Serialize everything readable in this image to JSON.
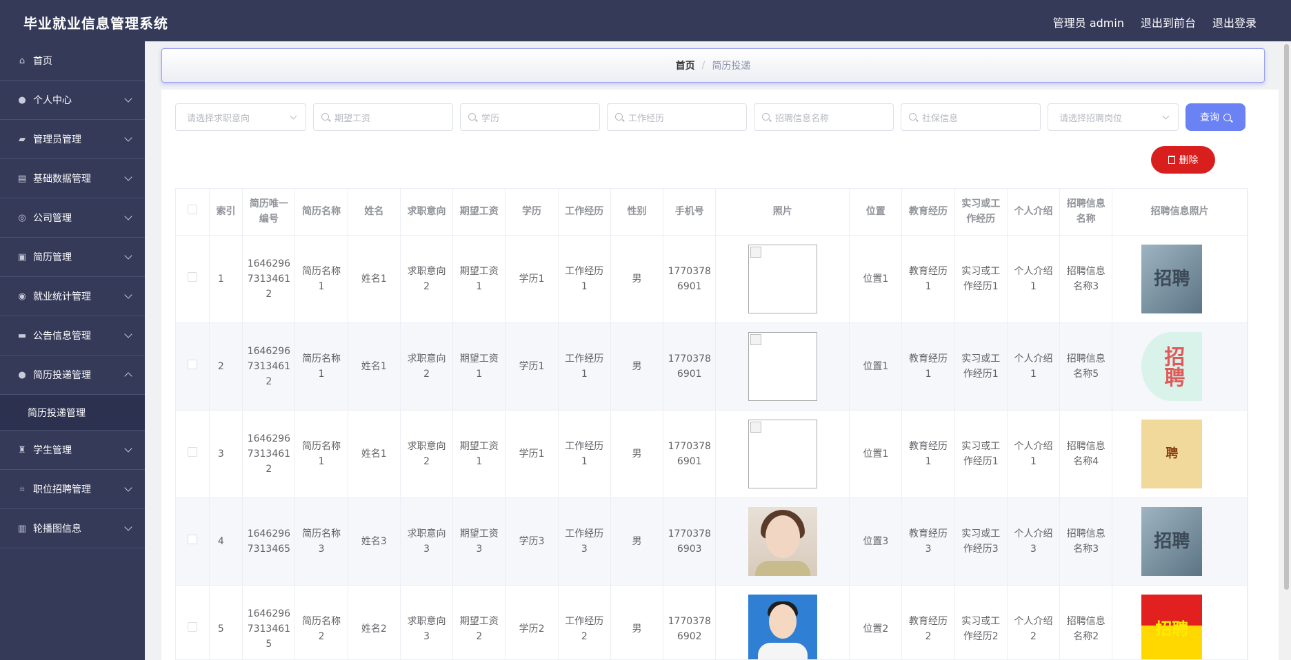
{
  "app": {
    "title": "毕业就业信息管理系统"
  },
  "topbar": {
    "admin_label": "管理员 admin",
    "front_label": "退出到前台",
    "logout_label": "退出登录"
  },
  "sidebar": {
    "items": [
      {
        "label": "首页",
        "icon": "home-icon"
      },
      {
        "label": "个人中心",
        "icon": "user-icon"
      },
      {
        "label": "管理员管理",
        "icon": "admin-icon"
      },
      {
        "label": "基础数据管理",
        "icon": "clipboard-icon"
      },
      {
        "label": "公司管理",
        "icon": "compass-icon"
      },
      {
        "label": "简历管理",
        "icon": "resume-icon"
      },
      {
        "label": "就业统计管理",
        "icon": "chart-circle-icon"
      },
      {
        "label": "公告信息管理",
        "icon": "briefcase-icon"
      },
      {
        "label": "简历投递管理",
        "icon": "user-icon"
      },
      {
        "label": "学生管理",
        "icon": "trophy-icon"
      },
      {
        "label": "职位招聘管理",
        "icon": "crop-icon"
      },
      {
        "label": "轮播图信息",
        "icon": "bar-chart-icon"
      }
    ],
    "sub_item": "简历投递管理"
  },
  "breadcrumb": {
    "home": "首页",
    "separator": "/",
    "current": "简历投递"
  },
  "filters": {
    "job_intent": "请选择求职意向",
    "salary": "期望工资",
    "education": "学历",
    "experience": "工作经历",
    "recruit_name": "招聘信息名称",
    "social": "社保信息",
    "position": "请选择招聘岗位",
    "query": "查询"
  },
  "delete_label": "删除",
  "table": {
    "headers": [
      "索引",
      "简历唯一编号",
      "简历名称",
      "姓名",
      "求职意向",
      "期望工资",
      "学历",
      "工作经历",
      "性别",
      "手机号",
      "照片",
      "位置",
      "教育经历",
      "实习或工作经历",
      "个人介绍",
      "招聘信息名称",
      "招聘信息照片"
    ],
    "rows": [
      {
        "index": "1",
        "uid": "16462967313461 2",
        "resume": "简历名称1",
        "name": "姓名1",
        "intent": "求职意向2",
        "salary": "期望工资1",
        "edu": "学历1",
        "work": "工作经历1",
        "gender": "男",
        "phone": "17703786901",
        "location": "位置1",
        "education_exp": "教育经历1",
        "intern": "实习或工作经历1",
        "intro": "个人介绍1",
        "recruit": "招聘信息名称3"
      },
      {
        "index": "2",
        "uid": "16462967313461 2",
        "resume": "简历名称1",
        "name": "姓名1",
        "intent": "求职意向2",
        "salary": "期望工资1",
        "edu": "学历1",
        "work": "工作经历1",
        "gender": "男",
        "phone": "17703786901",
        "location": "位置1",
        "education_exp": "教育经历1",
        "intern": "实习或工作经历1",
        "intro": "个人介绍1",
        "recruit": "招聘信息名称5"
      },
      {
        "index": "3",
        "uid": "16462967313461 2",
        "resume": "简历名称1",
        "name": "姓名1",
        "intent": "求职意向2",
        "salary": "期望工资1",
        "edu": "学历1",
        "work": "工作经历1",
        "gender": "男",
        "phone": "17703786901",
        "location": "位置1",
        "education_exp": "教育经历1",
        "intern": "实习或工作经历1",
        "intro": "个人介绍1",
        "recruit": "招聘信息名称4"
      },
      {
        "index": "4",
        "uid": "16462967313465",
        "resume": "简历名称3",
        "name": "姓名3",
        "intent": "求职意向3",
        "salary": "期望工资3",
        "edu": "学历3",
        "work": "工作经历3",
        "gender": "男",
        "phone": "17703786903",
        "location": "位置3",
        "education_exp": "教育经历3",
        "intern": "实习或工作经历3",
        "intro": "个人介绍3",
        "recruit": "招聘信息名称3"
      },
      {
        "index": "5",
        "uid": "16462967313461 5",
        "resume": "简历名称2",
        "name": "姓名2",
        "intent": "求职意向3",
        "salary": "期望工资2",
        "edu": "学历2",
        "work": "工作经历2",
        "gender": "男",
        "phone": "17703786902",
        "location": "位置2",
        "education_exp": "教育经历2",
        "intern": "实习或工作经历2",
        "intro": "个人介绍2",
        "recruit": "招聘信息名称2"
      }
    ],
    "recruit_image_texts": [
      "招聘",
      "招聘",
      "聘",
      "招聘",
      "招聘"
    ]
  },
  "colors": {
    "sidebar": "#353a59",
    "query_button": "#6b82f5",
    "delete_button": "#d91e1e"
  }
}
